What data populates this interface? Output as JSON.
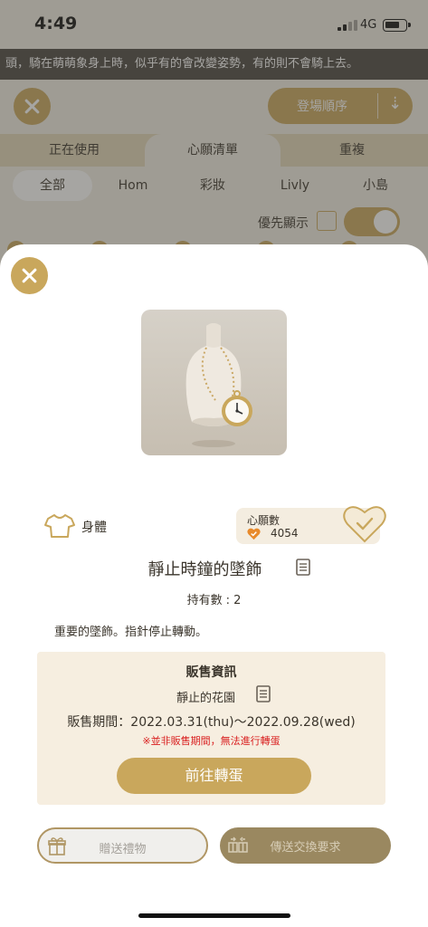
{
  "status_bar": {
    "time": "4:49",
    "network": "4G"
  },
  "background": {
    "marquee_text": "頭，騎在萌萌象身上時，似乎有的會改變姿勢，有的則不會騎上去。",
    "sort_label": "登場順序",
    "tabs": [
      {
        "label": "正在使用"
      },
      {
        "label": "心願清單"
      },
      {
        "label": "重複"
      }
    ],
    "subtabs": [
      {
        "label": "全部"
      },
      {
        "label": "Hom"
      },
      {
        "label": "彩妝"
      },
      {
        "label": "Livly"
      },
      {
        "label": "小島"
      }
    ],
    "priority_label": "優先顯示"
  },
  "sheet": {
    "category_label": "身體",
    "wish": {
      "title": "心願數",
      "count": "4054"
    },
    "item_name": "靜止時鐘的墜飾",
    "owned_label": "持有數",
    "owned_sep": ":",
    "owned_count": "2",
    "description": "重要的墜飾。指針停止轉動。",
    "sale": {
      "title": "販售資訊",
      "source": "靜止的花園",
      "period": "販售期間：2022.03.31(thu)〜2022.09.28(wed)",
      "note": "※並非販售期間，無法進行轉蛋",
      "button": "前往轉蛋"
    },
    "gift_button": "贈送禮物",
    "trade_button": "傳送交換要求"
  },
  "colors": {
    "accent_gold": "#c9a75c",
    "warning_red": "#d91f1f",
    "panel_beige": "#f6eee0"
  }
}
